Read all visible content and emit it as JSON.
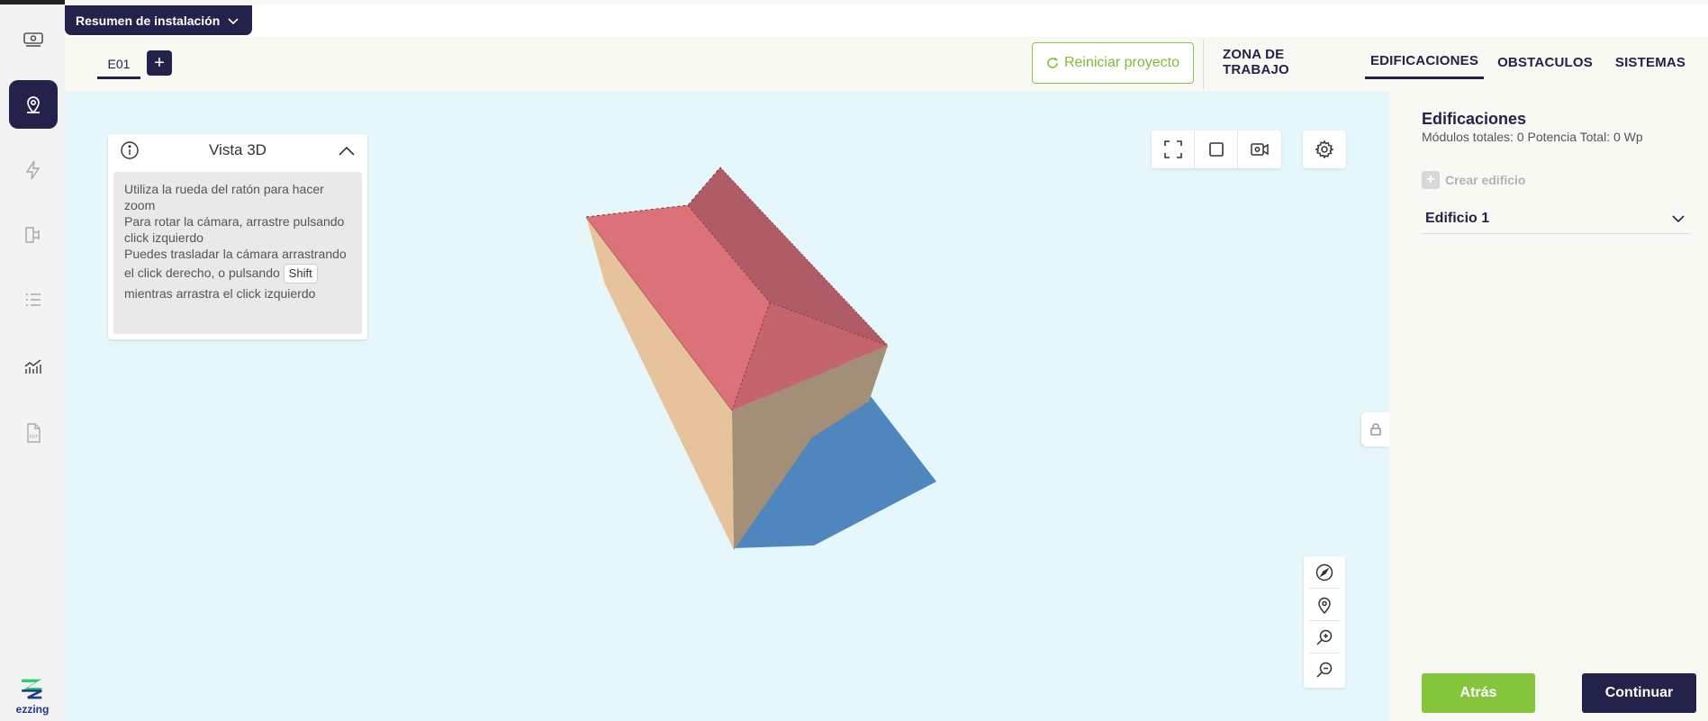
{
  "app": {
    "brand": "ezzing",
    "summary_button": "Resumen de instalación"
  },
  "rail": {
    "items": [
      {
        "icon": "money-icon"
      },
      {
        "icon": "location-icon",
        "active": true
      },
      {
        "icon": "lightning-icon"
      },
      {
        "icon": "connection-icon"
      },
      {
        "icon": "list-icon"
      },
      {
        "icon": "chart-icon"
      },
      {
        "icon": "pdf-icon"
      }
    ]
  },
  "tabs": {
    "floor": "E01",
    "add": "+",
    "reset": "Reiniciar proyecto",
    "nav": [
      {
        "label": "ZONA DE TRABAJO"
      },
      {
        "label": "EDIFICACIONES",
        "active": true
      },
      {
        "label": "OBSTACULOS"
      },
      {
        "label": "SISTEMAS"
      }
    ]
  },
  "info_panel": {
    "title": "Vista 3D",
    "line1": "Utiliza la rueda del ratón para hacer zoom",
    "line2": "Para rotar la cámara, arrastre pulsando click izquierdo",
    "line3": "Puedes trasladar la cámara arrastrando el click derecho, o pulsando",
    "key": "Shift",
    "line3_end": "mientras arrastra el click izquierdo"
  },
  "right_panel": {
    "title": "Edificaciones",
    "subtitle": "Módulos totales: 0 Potencia Total: 0 Wp",
    "create": "Crear edificio",
    "building": "Edificio 1",
    "back": "Atrás",
    "next": "Continuar"
  },
  "colors": {
    "navy": "#23224a",
    "green": "#84c53c",
    "sky": "#e6f7fc",
    "roof": "#dc7279",
    "roof_dark": "#b05c66",
    "wall": "#e6c39b",
    "wall_dark": "#a38e78",
    "shadow": "#4f86bd"
  }
}
